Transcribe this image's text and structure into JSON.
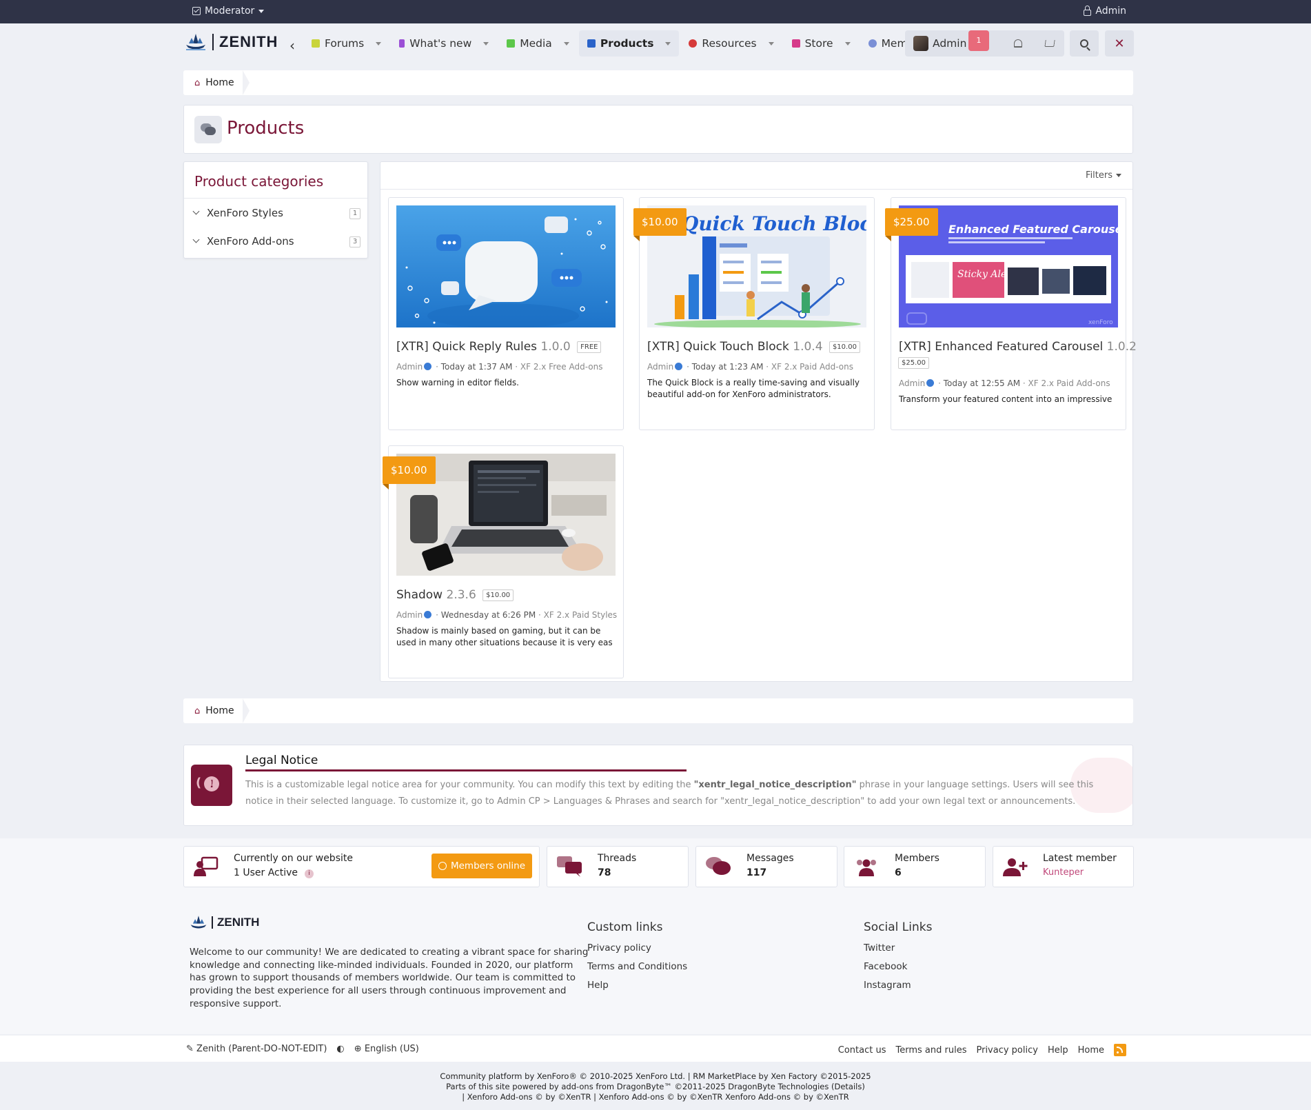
{
  "topbar": {
    "moderator_label": "Moderator",
    "admin_label": "Admin"
  },
  "header": {
    "brand": "ZENITH",
    "nav": [
      {
        "label": "Forums",
        "icon": "forums-icon",
        "color": "#c9d43a"
      },
      {
        "label": "What's new",
        "icon": "bolt-icon",
        "color": "#9b4fd6"
      },
      {
        "label": "Media",
        "icon": "camera-icon",
        "color": "#5cc74a"
      },
      {
        "label": "Products",
        "icon": "store-icon",
        "color": "#2a63c9"
      },
      {
        "label": "Resources",
        "icon": "cloud-icon",
        "color": "#d63a3a"
      },
      {
        "label": "Store",
        "icon": "cart-icon",
        "color": "#d63a8a"
      },
      {
        "label": "Members",
        "icon": "users-icon",
        "color": "#7a8fd6"
      }
    ],
    "user": "Admin",
    "notif_count": "1"
  },
  "breadcrumb": {
    "home": "Home"
  },
  "page": {
    "title": "Products"
  },
  "categories": {
    "title": "Product categories",
    "items": [
      {
        "label": "XenForo Styles",
        "count": "1"
      },
      {
        "label": "XenForo Add-ons",
        "count": "3"
      }
    ]
  },
  "filters_label": "Filters",
  "products": [
    {
      "title": "[XTR] Quick Reply Rules",
      "version": "1.0.0",
      "price_pill": "FREE",
      "price_tag": "",
      "author": "Admin",
      "time": "Today at 1:37 AM",
      "category": "XF 2.x Free Add-ons",
      "desc": "Show warning in editor fields."
    },
    {
      "title": "[XTR] Quick Touch Block",
      "version": "1.0.4",
      "price_pill": "$10.00",
      "price_tag": "$10.00",
      "thumb_text": "Quick Touch Block",
      "author": "Admin",
      "time": "Today at 1:23 AM",
      "category": "XF 2.x Paid Add-ons",
      "desc": "The Quick Block is a really time-saving and visually beautiful add-on for XenForo administrators."
    },
    {
      "title": "[XTR] Enhanced Featured Carousel",
      "version": "1.0.2",
      "price_pill": "$25.00",
      "price_tag": "$25.00",
      "thumb_text": "Enhanced Featured Carousel",
      "thumb_sub": "Sticky Alerts",
      "thumb_brand": "xenForo",
      "author": "Admin",
      "time": "Today at 12:55 AM",
      "category": "XF 2.x Paid Add-ons",
      "desc": "Transform your featured content into an impressive"
    },
    {
      "title": "Shadow",
      "version": "2.3.6",
      "price_pill": "$10.00",
      "price_tag": "$10.00",
      "author": "Admin",
      "time": "Wednesday at 6:26 PM",
      "category": "XF 2.x Paid Styles",
      "desc": "Shadow is mainly based on gaming, but it can be used in many other situations because it is very eas"
    }
  ],
  "notice": {
    "title": "Legal Notice",
    "text_1": "This is a customizable legal notice area for your community. You can modify this text by editing the ",
    "text_bold": "\"xentr_legal_notice_description\"",
    "text_2": " phrase in your language settings. Users will see this notice in their selected language. To customize it, go to Admin CP > Languages & Phrases and search for \"xentr_legal_notice_description\" to add your own legal text or announcements."
  },
  "stats": {
    "online_label": "Currently on our website",
    "online_value": "1 User Active",
    "online_button": "Members online",
    "threads_label": "Threads",
    "threads_value": "78",
    "messages_label": "Messages",
    "messages_value": "117",
    "members_label": "Members",
    "members_value": "6",
    "latest_label": "Latest member",
    "latest_value": "Kunteper"
  },
  "footer": {
    "brand": "ZENITH",
    "about": "Welcome to our community! We are dedicated to creating a vibrant space for sharing knowledge and connecting like-minded individuals. Founded in 2020, our platform has grown to support thousands of members worldwide. Our team is committed to providing the best experience for all users through continuous improvement and responsive support.",
    "custom_title": "Custom links",
    "custom_links": [
      "Privacy policy",
      "Terms and Conditions",
      "Help"
    ],
    "social_title": "Social Links",
    "social_links": [
      "Twitter",
      "Facebook",
      "Instagram"
    ],
    "style_name": "Zenith (Parent-DO-NOT-EDIT)",
    "language": "English (US)",
    "bar_links": [
      "Contact us",
      "Terms and rules",
      "Privacy policy",
      "Help",
      "Home"
    ],
    "copy_1": "Community platform by XenForo® © 2010-2025 XenForo Ltd. | RM MarketPlace by Xen Factory ©2015-2025",
    "copy_2": "Parts of this site powered by add-ons from DragonByte™ ©2011-2025 DragonByte Technologies (Details)",
    "copy_3": "| Xenforo Add-ons © by ©XenTR | Xenforo Add-ons © by ©XenTR Xenforo Add-ons © by ©XenTR"
  },
  "colors": {
    "accent": "#7a1637",
    "orange": "#f39a12",
    "topbar": "#2f3347"
  }
}
